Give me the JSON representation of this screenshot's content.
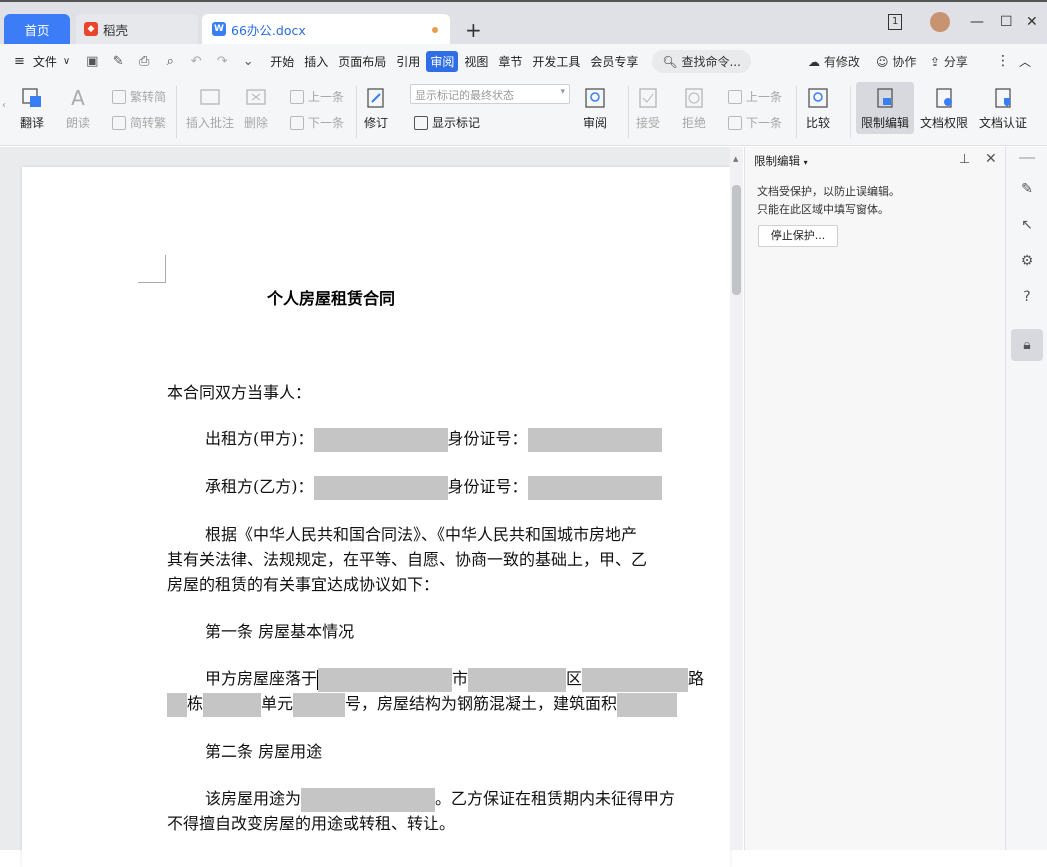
{
  "tabs": {
    "home": "首页",
    "daoke": "稻壳",
    "doc": "66办公.docx"
  },
  "menu": {
    "file": "文件",
    "items": [
      "开始",
      "插入",
      "页面布局",
      "引用",
      "审阅",
      "视图",
      "章节",
      "开发工具",
      "会员专享"
    ],
    "search": "查找命令...",
    "modified": "有修改",
    "collab": "协作",
    "share": "分享"
  },
  "ribbon": {
    "translate": "翻译",
    "read_aloud": "朗读",
    "trad_simp": "繁转简",
    "simp_trad": "简转繁",
    "insert_comment": "插入批注",
    "delete": "删除",
    "prev": "上一条",
    "next": "下一条",
    "revise": "修订",
    "markup_select": "显示标记的最终状态",
    "show_markup": "显示标记",
    "review": "审阅",
    "accept": "接受",
    "reject": "拒绝",
    "prev2": "上一条",
    "next2": "下一条",
    "compare": "比较",
    "restrict_edit": "限制编辑",
    "doc_permission": "文档权限",
    "doc_cert": "文档认证"
  },
  "document": {
    "title": "个人房屋租赁合同",
    "parties_intro": "本合同双方当事人：",
    "lessor_label": "出租方(甲方)：",
    "id_label": "身份证号：",
    "lessee_label": "承租方(乙方)：",
    "para1_line1": "根据《中华人民共和国合同法》、《中华人民共和国城市房地产",
    "para1_line2": "其有关法律、法规规定，在平等、自愿、协商一致的基础上，甲、乙",
    "para1_line3": "房屋的租赁的有关事宜达成协议如下：",
    "art1": "第一条  房屋基本情况",
    "loc_prefix": "甲方房屋座落于",
    "loc_city": "市",
    "loc_district": "区",
    "loc_road": "路",
    "loc_building": "栋",
    "loc_unit": "单元",
    "loc_room": "号，房屋结构为钢筋混凝土，建筑面积",
    "art2": "第二条  房屋用途",
    "use_prefix": "该房屋用途为",
    "use_suffix": "。乙方保证在租赁期内未征得甲方",
    "use_line2": "不得擅自改变房屋的用途或转租、转让。"
  },
  "panel": {
    "title": "限制编辑",
    "line1": "文档受保护，以防止误编辑。",
    "line2": "只能在此区域中填写窗体。",
    "stop_button": "停止保护..."
  }
}
